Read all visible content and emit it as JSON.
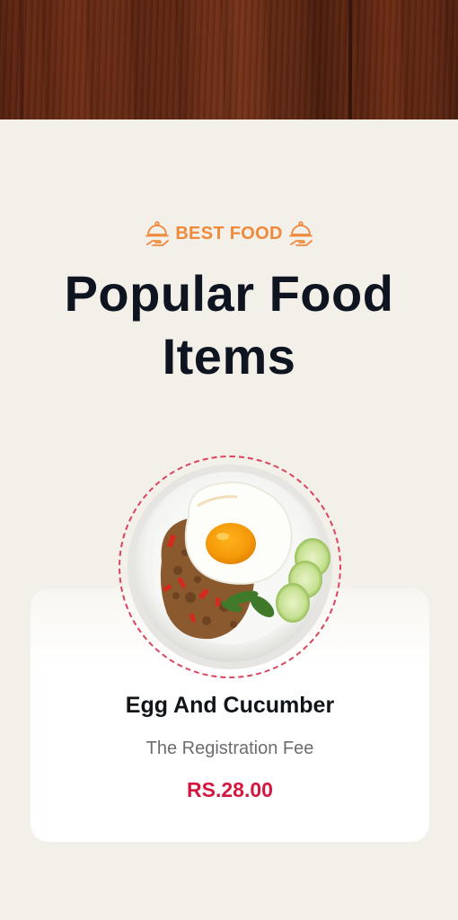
{
  "header": {
    "banner_image": "wood-texture-banner"
  },
  "section": {
    "tag_label": "BEST FOOD",
    "tag_icon": "cloche-icon",
    "title": "Popular Food Items"
  },
  "featured_item": {
    "image": "egg-and-cucumber-plate",
    "name": "Egg And Cucumber",
    "description": "The Registration Fee",
    "price": "RS.28.00"
  },
  "colors": {
    "accent_orange": "#f0893a",
    "price_red": "#d4173f",
    "title_dark": "#0f1520",
    "background": "#f3f0e9",
    "card_bg": "#ffffff",
    "dashed_ring": "#d9455e"
  }
}
